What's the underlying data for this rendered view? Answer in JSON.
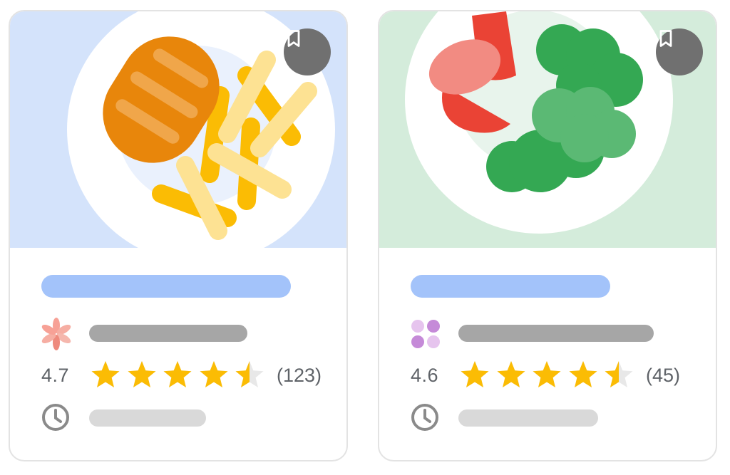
{
  "colors": {
    "card_border": "#e3e3e3",
    "title_bar": "#a3c3fa",
    "source_bar": "#a6a6a6",
    "time_bar": "#d9d9d9",
    "star_filled": "#fbbc04",
    "star_empty": "#e8e8e8",
    "bookmark_bg": "#707070",
    "plate": "#ffffff"
  },
  "cards": [
    {
      "hero_bg": "#d4e3fb",
      "dish": "chicken-and-fries",
      "bookmark_icon": "bookmark-icon",
      "source_logo": "flower-logo-icon",
      "rating": "4.7",
      "rating_value": 4.7,
      "review_count": "(123)",
      "time_icon": "clock-icon"
    },
    {
      "hero_bg": "#d4ecdb",
      "dish": "salad-with-tomato-and-broccoli",
      "bookmark_icon": "bookmark-icon",
      "source_logo": "four-dots-logo-icon",
      "rating": "4.6",
      "rating_value": 4.6,
      "review_count": "(45)",
      "time_icon": "clock-icon"
    }
  ]
}
